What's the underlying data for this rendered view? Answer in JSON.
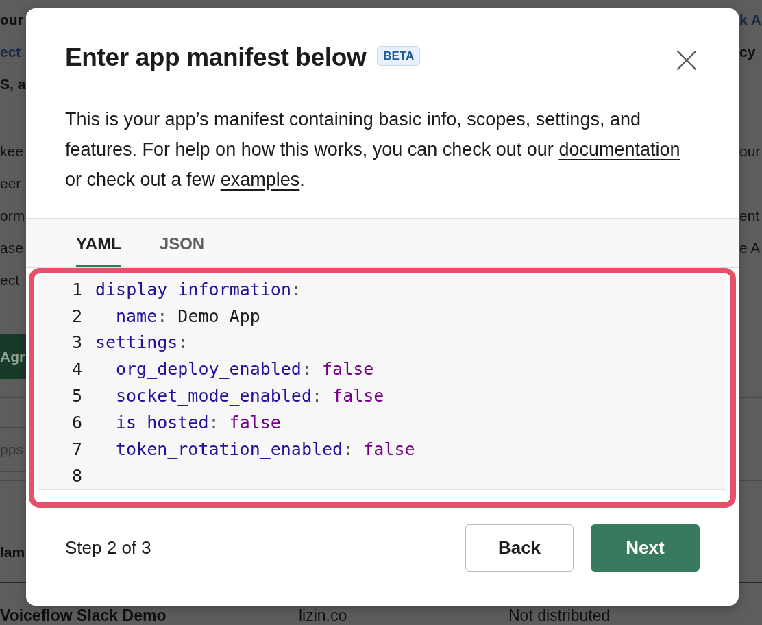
{
  "background": {
    "heading_lines": [
      {
        "left": {
          "kind": "bold",
          "text": "our"
        },
        "right": {
          "kind": "link",
          "text": "k A"
        }
      },
      {
        "left": {
          "kind": "link",
          "text": "ect"
        },
        "right": {
          "kind": "bold",
          "text": "cy"
        }
      },
      {
        "left": {
          "kind": "bold",
          "text": "S, a"
        }
      }
    ],
    "paragraph_lines": [
      {
        "left": {
          "kind": "text",
          "text": "kee"
        },
        "right": {
          "kind": "text",
          "text": "our"
        }
      },
      {
        "left": {
          "kind": "text",
          "text": "eer"
        }
      },
      {
        "left": {
          "kind": "text",
          "text": "orm"
        },
        "right": {
          "kind": "text",
          "text": "ent"
        }
      },
      {
        "left": {
          "kind": "text",
          "text": "ase"
        },
        "right": {
          "kind": "text",
          "text": "e A"
        }
      },
      {
        "left": {
          "kind": "text",
          "text": "ect"
        }
      }
    ],
    "button": {
      "label": "Agr"
    },
    "search_field": {
      "placeholder": "pps"
    },
    "column_header": {
      "kind": "bold",
      "text": "lam"
    },
    "table_row": [
      {
        "kind": "bold",
        "text": "Voiceflow Slack Demo"
      },
      {
        "kind": "text",
        "text": "lizin.co"
      },
      {
        "kind": "text",
        "text": "Not distributed"
      }
    ]
  },
  "dialog": {
    "title": "Enter app manifest below",
    "badge": "BETA",
    "description": [
      {
        "kind": "text",
        "text": "This is your app’s manifest containing basic info, scopes, settings, and features. For help on how this works, you can check out our "
      },
      {
        "kind": "link",
        "text": "documentation"
      },
      {
        "kind": "text",
        "text": " or check out a few "
      },
      {
        "kind": "link",
        "text": "examples"
      },
      {
        "kind": "text",
        "text": "."
      }
    ],
    "tabs": [
      {
        "label": "YAML",
        "selected": true
      },
      {
        "label": "JSON",
        "selected": false
      }
    ],
    "editor": {
      "highlighted": true,
      "lines": [
        {
          "number": "1",
          "tokens": [
            {
              "kind": "key",
              "text": "display_information"
            },
            {
              "kind": "punct",
              "text": ":"
            }
          ],
          "children": [
            {
              "number": "2",
              "tokens": [
                {
                  "kind": "key",
                  "text": "name"
                },
                {
                  "kind": "punct",
                  "text": ": "
                },
                {
                  "kind": "string",
                  "text": "Demo App"
                }
              ]
            }
          ]
        },
        {
          "number": "3",
          "tokens": [
            {
              "kind": "key",
              "text": "settings"
            },
            {
              "kind": "punct",
              "text": ":"
            }
          ],
          "children": [
            {
              "number": "4",
              "tokens": [
                {
                  "kind": "key",
                  "text": "org_deploy_enabled"
                },
                {
                  "kind": "punct",
                  "text": ": "
                },
                {
                  "kind": "keyword",
                  "text": "false"
                }
              ]
            },
            {
              "number": "5",
              "tokens": [
                {
                  "kind": "key",
                  "text": "socket_mode_enabled"
                },
                {
                  "kind": "punct",
                  "text": ": "
                },
                {
                  "kind": "keyword",
                  "text": "false"
                }
              ]
            },
            {
              "number": "6",
              "tokens": [
                {
                  "kind": "key",
                  "text": "is_hosted"
                },
                {
                  "kind": "punct",
                  "text": ": "
                },
                {
                  "kind": "keyword",
                  "text": "false"
                }
              ]
            },
            {
              "number": "7",
              "tokens": [
                {
                  "kind": "key",
                  "text": "token_rotation_enabled"
                },
                {
                  "kind": "punct",
                  "text": ": "
                },
                {
                  "kind": "keyword",
                  "text": "false"
                }
              ]
            }
          ]
        },
        {
          "number": "8"
        }
      ]
    },
    "footer": {
      "step": "Step 2 of 3",
      "buttons": [
        {
          "kind": "secondary",
          "label": "Back"
        },
        {
          "kind": "primary",
          "label": "Next"
        }
      ]
    }
  }
}
